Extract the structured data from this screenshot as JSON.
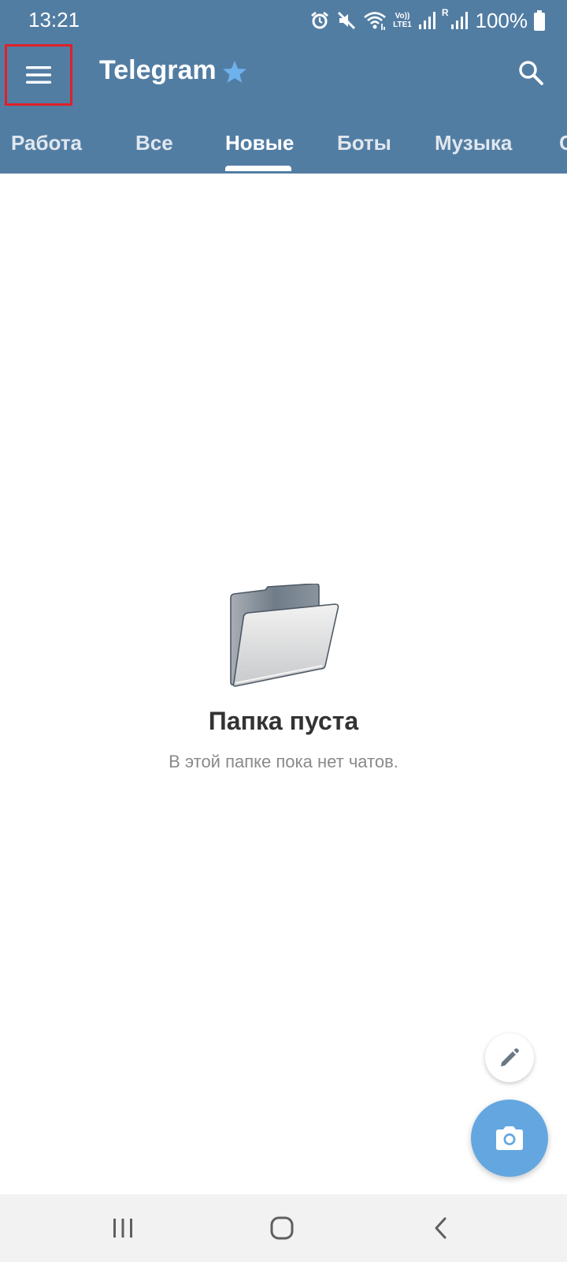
{
  "status_bar": {
    "time": "13:21",
    "volte_top": "Vo))",
    "volte_bottom": "LTE1",
    "roaming": "R",
    "battery_percent": "100%"
  },
  "header": {
    "title": "Telegram",
    "icons": [
      "menu-icon",
      "star-icon",
      "search-icon"
    ]
  },
  "tabs": [
    {
      "label": "Работа",
      "active": false
    },
    {
      "label": "Все",
      "active": false
    },
    {
      "label": "Новые",
      "active": true
    },
    {
      "label": "Боты",
      "active": false
    },
    {
      "label": "Музыка",
      "active": false
    }
  ],
  "tab_overflow": "С",
  "empty_state": {
    "title": "Папка пуста",
    "subtitle": "В этой папке пока нет чатов."
  },
  "fabs": [
    "pencil-icon",
    "camera-icon"
  ],
  "navigation": [
    "recents-icon",
    "home-icon",
    "back-icon"
  ],
  "colors": {
    "header_bg": "#527da3",
    "fab_bg": "#64a7e0",
    "highlight_border": "#e0202a",
    "star": "#6fb1ec"
  }
}
